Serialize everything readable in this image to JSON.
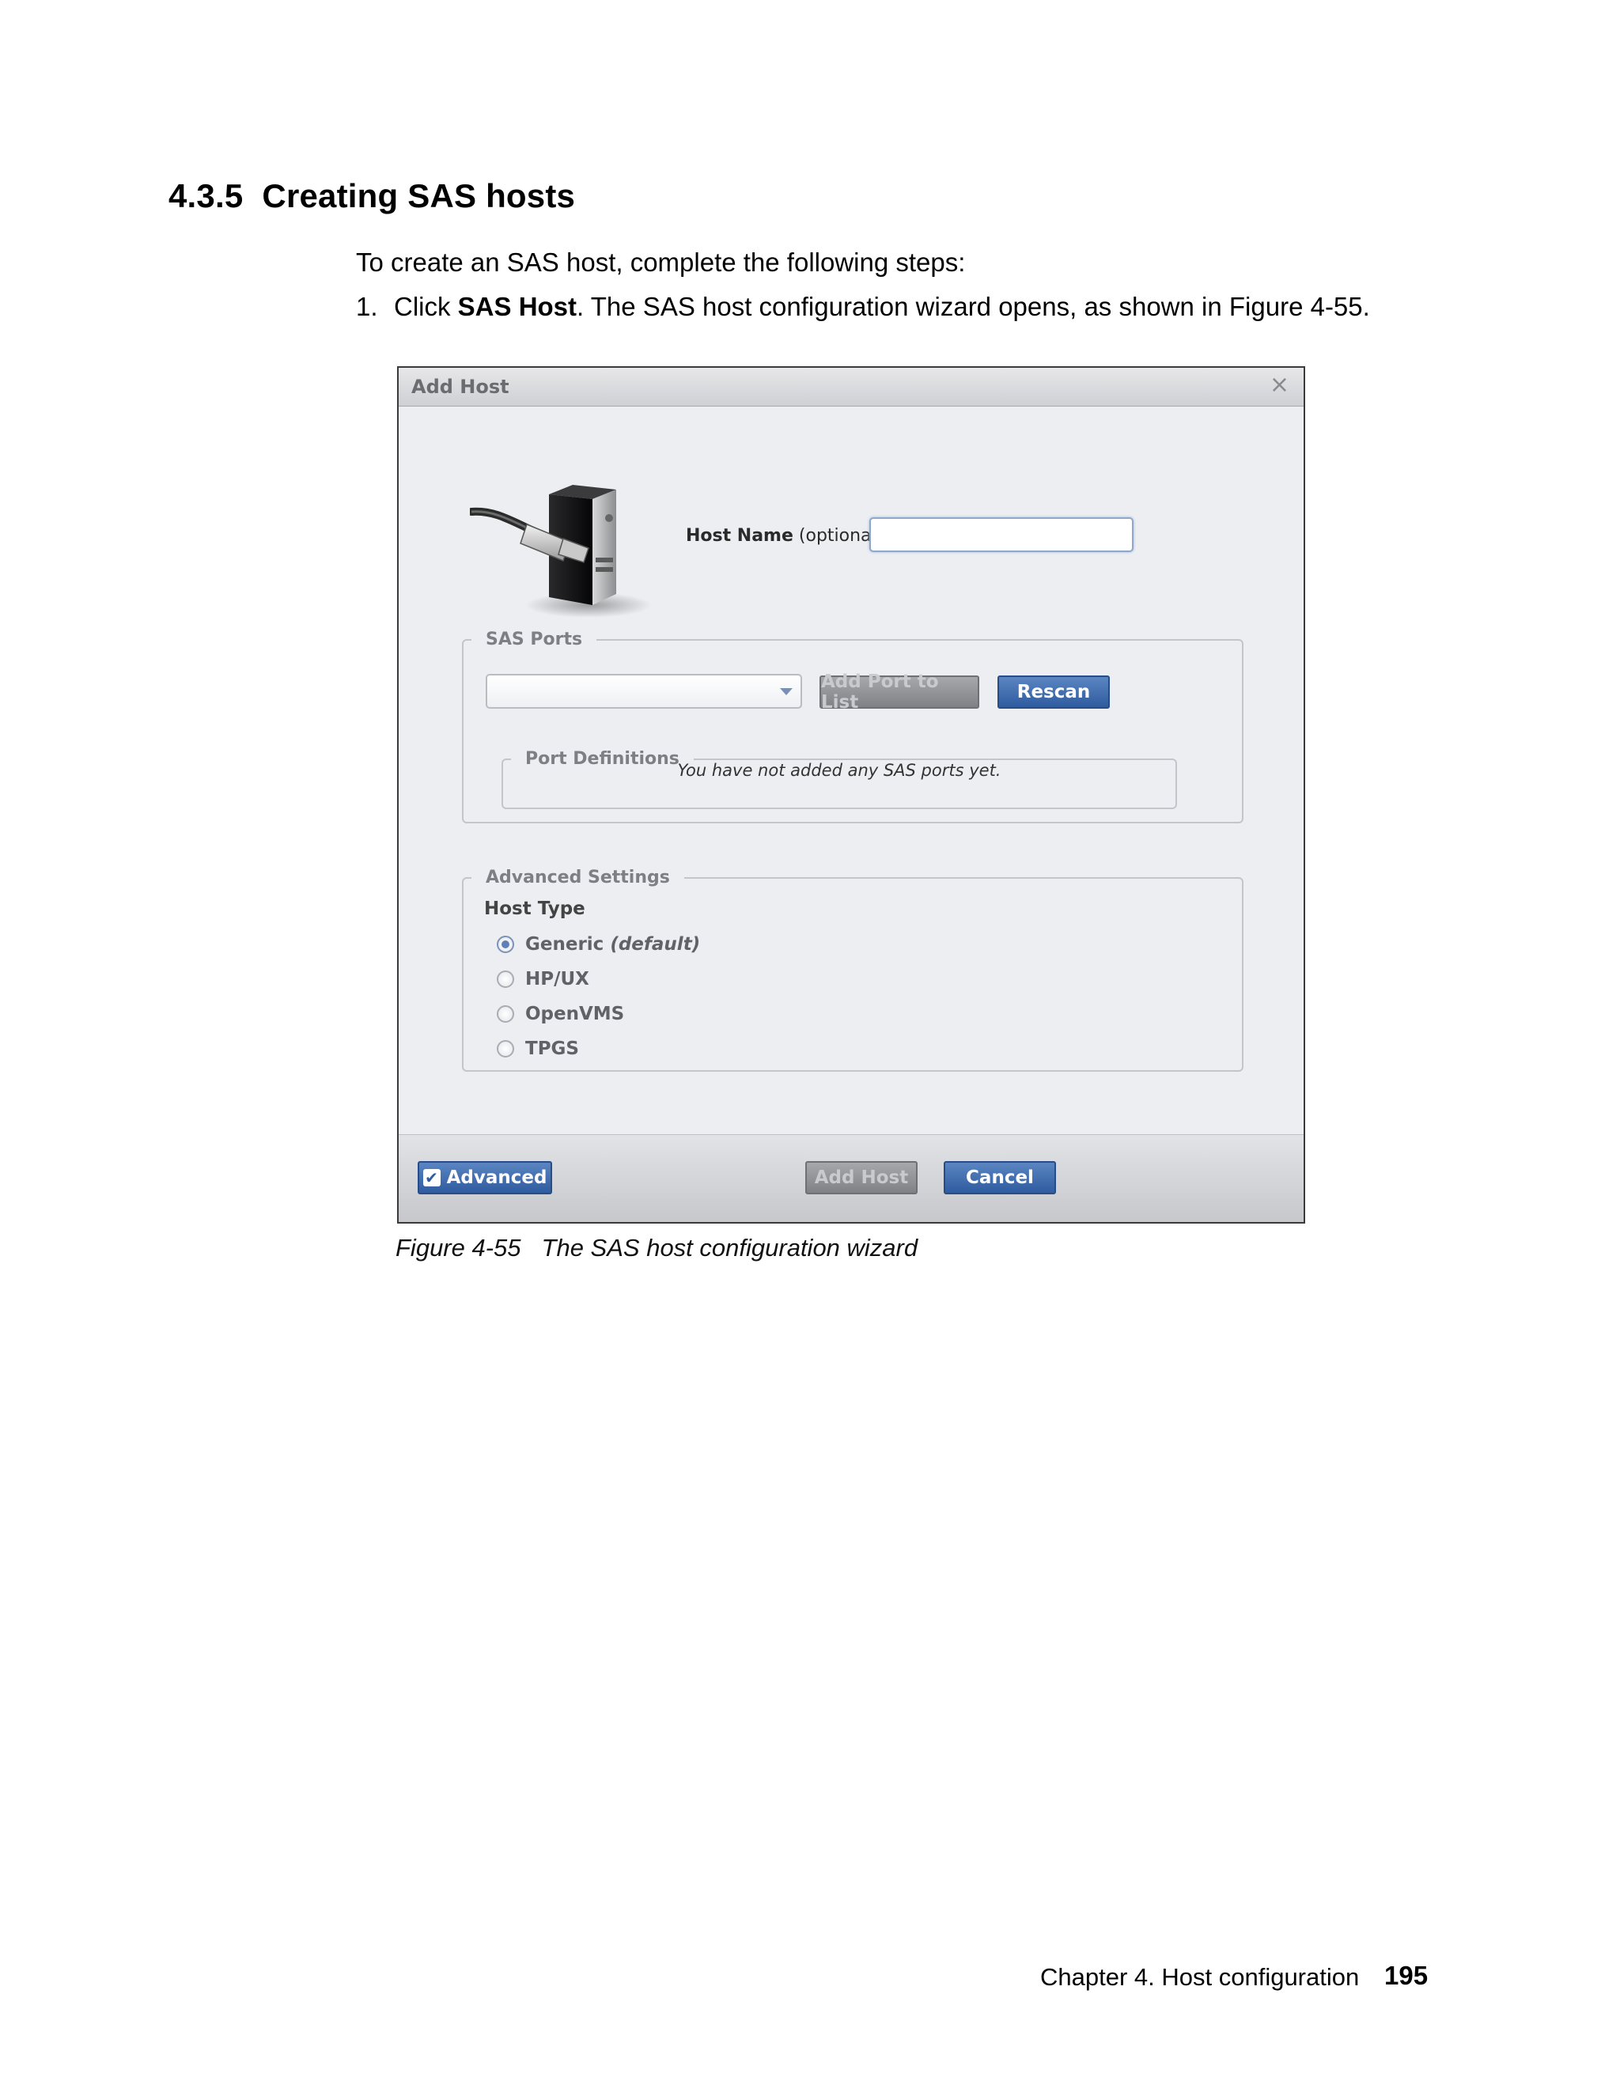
{
  "section": {
    "number": "4.3.5",
    "title": "Creating SAS hosts"
  },
  "intro_text": "To create an SAS host, complete the following steps:",
  "steps": [
    {
      "index": "1.",
      "prefix": "Click ",
      "bold": "SAS Host",
      "suffix": ". The SAS host configuration wizard opens, as shown in Figure 4-55."
    }
  ],
  "dialog": {
    "title": "Add Host",
    "close_glyph": "×",
    "host_name_label": "Host Name",
    "host_name_optional": "(optional):",
    "host_name_value": "",
    "sas_ports": {
      "legend": "SAS Ports",
      "select_value": "",
      "add_port_label": "Add Port to List",
      "rescan_label": "Rescan"
    },
    "port_definitions": {
      "legend": "Port Definitions",
      "empty_message": "You have not added any SAS ports yet."
    },
    "advanced_settings": {
      "legend": "Advanced Settings",
      "host_type_label": "Host Type",
      "options": [
        {
          "label": "Generic",
          "suffix": "(default)",
          "checked": true
        },
        {
          "label": "HP/UX",
          "suffix": "",
          "checked": false
        },
        {
          "label": "OpenVMS",
          "suffix": "",
          "checked": false
        },
        {
          "label": "TPGS",
          "suffix": "",
          "checked": false
        }
      ]
    },
    "footer": {
      "advanced_label": "Advanced",
      "advanced_checked": true,
      "add_host_label": "Add Host",
      "cancel_label": "Cancel"
    }
  },
  "caption": {
    "figure": "Figure 4-55",
    "text": "The SAS host configuration wizard"
  },
  "page_footer": {
    "chapter": "Chapter 4. Host configuration",
    "page_number": "195"
  },
  "colors": {
    "primary_button": "#2f5c9f",
    "disabled_button": "#7f8186",
    "dialog_bg": "#eceef2"
  }
}
